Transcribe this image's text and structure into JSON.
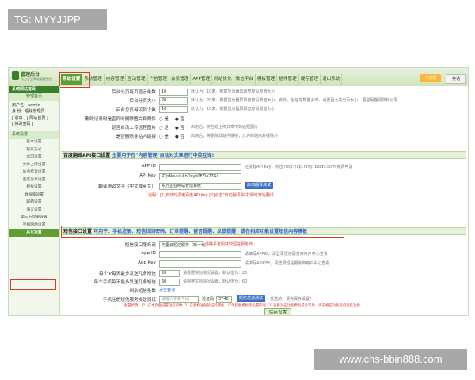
{
  "watermarks": {
    "top_left": "TG: MYYJJPP",
    "bottom_right": "www.chs-bbin888.com"
  },
  "logo": {
    "title": "管理后台",
    "subtitle": "东方企业网站管理系统"
  },
  "nav": {
    "tabs": [
      "系统设置",
      "系统管理",
      "内容管理",
      "互动管理",
      "广告管理",
      "会员管理",
      "APP管理",
      "网站优化",
      "微信平台",
      "模板管理",
      "插件管理",
      "缓存管理",
      "退出系统"
    ],
    "active_index": 0,
    "right_buttons": [
      "中文版",
      "英语"
    ]
  },
  "sidebar": {
    "header": "系统网站首页",
    "home": "管理首页",
    "user_lines": [
      "用户名：admin",
      "身 份：超级管理员",
      "[ 退出 ] [ 网站首页 ]",
      "[ 修改密码 ]"
    ],
    "section": "系统设置",
    "items": [
      "基本设置",
      "联系方式",
      "水印设置",
      "文件上传设置",
      "站点统计设置",
      "百度分享设置",
      "模板设置",
      "数据库设置",
      "邮箱设置",
      "语言设置",
      "第三方登录设置",
      "手机网站设置",
      "其它设置"
    ],
    "active_index": 12
  },
  "form": {
    "rows_top": [
      {
        "label": "后台分页每页显示条数",
        "value": "10",
        "hint": "默认为：10条。根据显示器屏幕宽度设置值大小"
      },
      {
        "label": "后台分页大小",
        "value": "20",
        "hint": "默认为：20条。根据显示器屏幕宽度设置值大小。此外，当信息数量多时，设置更大的分页大小，更容易翻阅所有记录"
      },
      {
        "label": "后台分页每页码个数",
        "value": "10",
        "hint": "默认为：10条。根据显示器屏幕宽度设置值大小"
      }
    ],
    "radios": [
      {
        "label": "删除记录时是否同时删除图片和附件",
        "opt1": "是",
        "opt2": "否",
        "hint": ""
      },
      {
        "label": "是否自动上传远程图片",
        "opt1": "是",
        "opt2": "否",
        "hint": "启用后，将自动上传文章中的远程图片"
      },
      {
        "label": "是否删除非站内链接",
        "opt1": "是",
        "opt2": "否",
        "hint": "启用后，将删除非站内链接，允许的站内外链除外"
      }
    ],
    "baidu_section": {
      "title": "百度翻译API接口设置",
      "tip": "主要用于在\"内容管理\"自动对文章进行中英互译!"
    },
    "baidu_rows": [
      {
        "label": "APP ID",
        "value": "",
        "hint": "还没有API Key，点击 http://api.fanyi.baidu.com 免费申请"
      },
      {
        "label": "API Key",
        "value": "RTpNovuluLhDsyb0FZla27Gi",
        "hint": ""
      },
      {
        "label": "翻译测试文字（中文或英文）",
        "value": "东方企业网站管理系统",
        "button": "启动翻译测试"
      }
    ],
    "baidu_note": "说明：[1]启动时调用百度API Key [2]点击\"启动翻译测试\"即可开始翻译",
    "sms_section": {
      "title": "短信接口设置",
      "tip": "可用于：手机注册、短信找回密码、订单提醒、留言提醒、反馈提醒，请在相应功能设置短信内容模板"
    },
    "sms_rows": [
      {
        "label": "短信接口服务商",
        "value": "阿里云短信服务（新一代）",
        "hint": "请联系客服获取短信服务商"
      },
      {
        "label": "App ID",
        "value": "",
        "hint": "请填写APPID，请登录短信服务商用户中心查看"
      },
      {
        "label": "App Key",
        "value": "",
        "hint": "请填写APIKEY，请登录短信服务商用户中心查看"
      },
      {
        "label": "每个IP每天最多发送几条短信",
        "value": "20",
        "hint": "请根据实际情况设置，默认值为：20"
      },
      {
        "label": "每个手机每天最多发送几条短信",
        "value": "60",
        "hint": "请根据实际情况设置，默认值为：60"
      },
      {
        "label": "剩余短信条数",
        "value": "",
        "hint": "点击查询"
      }
    ],
    "sms_test": {
      "label": "手机注册短信服务发送测试",
      "placeholder": "请输入手机号码",
      "code_label": "验证码",
      "code": "3740",
      "button": "短信发送测试",
      "hint": "发送前，请先保存设置！"
    },
    "sms_note": "配置步骤：[1] 在本页面设置短信参数 [2] 在手机注册验证码模板、订单提醒模板等设置内容  [3] 查看对应功能模板是否可用，再去相应功能开启短信功能",
    "save": "保存设置"
  }
}
